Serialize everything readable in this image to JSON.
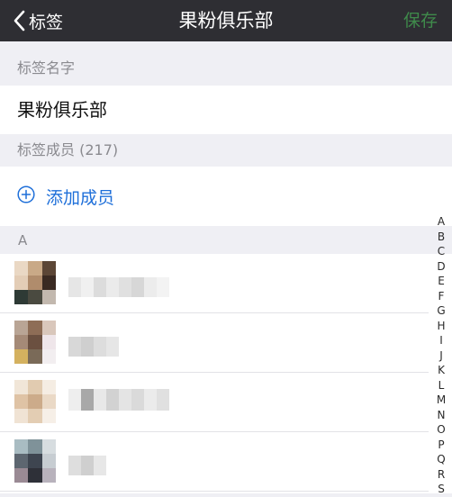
{
  "navbar": {
    "back_label": "标签",
    "title": "果粉俱乐部",
    "save_label": "保存",
    "save_color": "#3f8a4b"
  },
  "tag_name_section": {
    "header": "标签名字",
    "value": "果粉俱乐部"
  },
  "members_section": {
    "header": "标签成员 (217)",
    "add_label": "添加成员",
    "add_icon": "plus-circle-icon",
    "accent_color": "#1e6fd9"
  },
  "group_letter": "A",
  "index_letters": [
    "A",
    "B",
    "C",
    "D",
    "E",
    "F",
    "G",
    "H",
    "I",
    "J",
    "K",
    "L",
    "M",
    "N",
    "O",
    "P",
    "Q",
    "R",
    "S"
  ],
  "members": [
    {
      "note": "blurred-avatar-and-name"
    },
    {
      "note": "blurred-avatar-and-name"
    },
    {
      "note": "blurred-avatar-and-name"
    },
    {
      "note": "blurred-avatar-and-name"
    }
  ]
}
